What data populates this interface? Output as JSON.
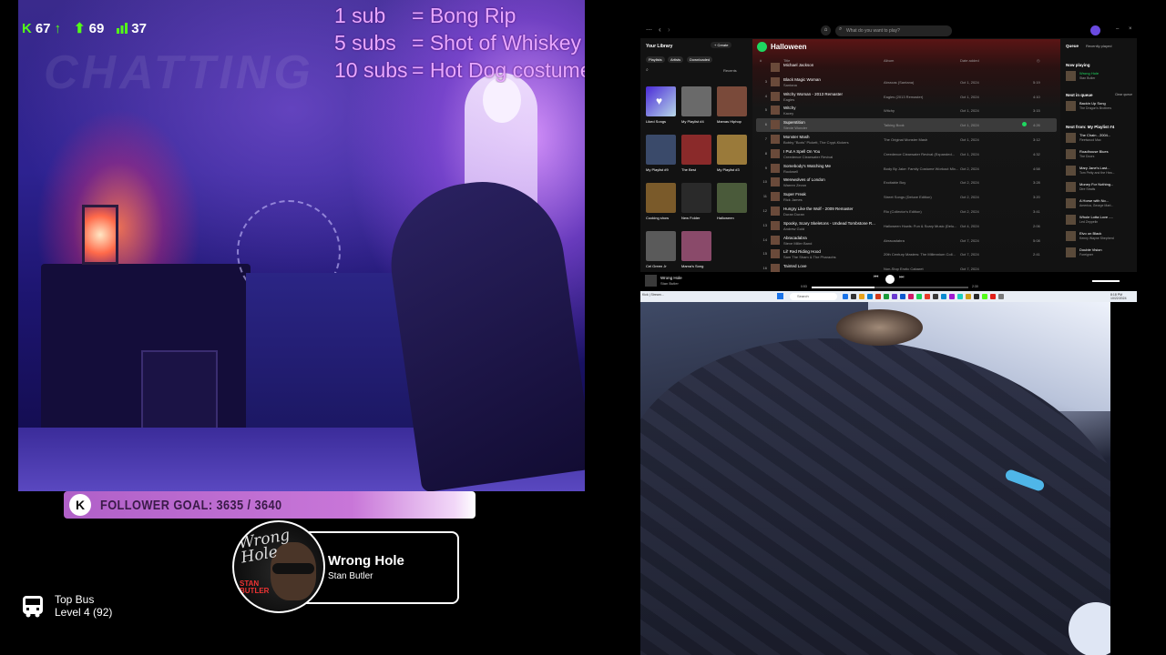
{
  "stream": {
    "stats": [
      {
        "icon": "kick-icon",
        "glyph": "K",
        "value": "67",
        "trend": "↑"
      },
      {
        "icon": "person-icon",
        "glyph": "⬆",
        "value": "69"
      },
      {
        "icon": "bars-icon",
        "glyph": "▮",
        "value": "37"
      }
    ],
    "watermark": "CHATTING",
    "sub_goals": [
      {
        "count": "1 sub",
        "reward": "= Bong Rip"
      },
      {
        "count": "5 subs",
        "reward": "= Shot of Whiskey"
      },
      {
        "count": "10 subs",
        "reward": "= Hot Dog costume"
      }
    ],
    "follower_goal": {
      "label": "FOLLOWER GOAL: 3635 / 3640",
      "current": 3635,
      "target": 3640
    },
    "now_playing": {
      "title": "Wrong Hole",
      "artist": "Stan Butler",
      "art_title": "Wrong Hole",
      "art_artist": "STAN BUTLER"
    },
    "top_bus": {
      "title": "Top Bus",
      "level": "Level 4  (92)"
    }
  },
  "spotify": {
    "search_placeholder": "What do you want to play?",
    "library_title": "Your Library",
    "create_label": "+ Create",
    "chips": [
      "Playlists",
      "Artists",
      "Downloaded"
    ],
    "sort_label": "Recents",
    "library_tiles": [
      {
        "name": "Liked Songs",
        "color": "#5b3be0"
      },
      {
        "name": "My Playlist #4",
        "color": "#6a6a6a"
      },
      {
        "name": "Mamas Hiphop",
        "color": "#7a4a3a"
      },
      {
        "name": "My Playlist #9",
        "color": "#3a4a6a"
      },
      {
        "name": "The Best",
        "color": "#8a2a2a"
      },
      {
        "name": "My Playlist #3",
        "color": "#9a7a3a"
      },
      {
        "name": "Cooking show",
        "color": "#7a5a2a"
      },
      {
        "name": "New Folder",
        "color": "#2a2a2a"
      },
      {
        "name": "Halloween",
        "color": "#4a5a3a"
      },
      {
        "name": "Cel Green Jr",
        "color": "#5a5a5a"
      },
      {
        "name": "Mama's Song",
        "color": "#8a4a6a"
      }
    ],
    "playlist_title": "Halloween",
    "columns": {
      "num": "#",
      "title": "Title",
      "album": "Album",
      "date": "Date added",
      "duration": "◷"
    },
    "tracks": [
      {
        "n": "",
        "title": "Michael Jackson",
        "artist": "",
        "album": "",
        "date": "",
        "dur": ""
      },
      {
        "n": "3",
        "title": "Black Magic Woman",
        "artist": "Santana",
        "album": "Abraxas (Santana)",
        "date": "Oct 1, 2024",
        "dur": "5:19"
      },
      {
        "n": "4",
        "title": "Witchy Woman - 2013 Remaster",
        "artist": "Eagles",
        "album": "Eagles (2013 Remaster)",
        "date": "Oct 1, 2024",
        "dur": "4:10"
      },
      {
        "n": "5",
        "title": "Witchy",
        "artist": "Kacey",
        "album": "Witchy",
        "date": "Oct 1, 2024",
        "dur": "3:15"
      },
      {
        "n": "6",
        "title": "Superstition",
        "artist": "Stevie Wonder",
        "album": "Talking Book",
        "date": "Oct 1, 2024",
        "dur": "4:26",
        "selected": true
      },
      {
        "n": "7",
        "title": "Monster Mash",
        "artist": "Bobby \"Boris\" Pickett, The Crypt-Kickers",
        "album": "The Original Monster Mash",
        "date": "Oct 1, 2024",
        "dur": "3:12"
      },
      {
        "n": "8",
        "title": "I Put A Spell On You",
        "artist": "Creedence Clearwater Revival",
        "album": "Creedence Clearwater Revival (Expanded...",
        "date": "Oct 1, 2024",
        "dur": "4:32"
      },
      {
        "n": "9",
        "title": "Somebody's Watching Me",
        "artist": "Rockwell",
        "album": "Body By Jake: Family Costume Workout Mix...",
        "date": "Oct 2, 2024",
        "dur": "4:58"
      },
      {
        "n": "10",
        "title": "Werewolves of London",
        "artist": "Warren Zevon",
        "album": "Excitable Boy",
        "date": "Oct 2, 2024",
        "dur": "3:28"
      },
      {
        "n": "11",
        "title": "Super Freak",
        "artist": "Rick James",
        "album": "Street Songs (Deluxe Edition)",
        "date": "Oct 2, 2024",
        "dur": "3:20"
      },
      {
        "n": "12",
        "title": "Hungry Like the Wolf - 2009 Remaster",
        "artist": "Duran Duran",
        "album": "Rio (Collector's Edition)",
        "date": "Oct 2, 2024",
        "dur": "3:41"
      },
      {
        "n": "13",
        "title": "Spooky, Scary Skeletons - Undead Tombstone R...",
        "artist": "Andrew Gold",
        "album": "Halloween Howls: Fun & Scary Music (Delu...",
        "date": "Oct 4, 2024",
        "dur": "2:06"
      },
      {
        "n": "14",
        "title": "Abracadabra",
        "artist": "Steve Miller Band",
        "album": "Abracadabra",
        "date": "Oct 7, 2024",
        "dur": "5:08"
      },
      {
        "n": "15",
        "title": "Lil' Red Riding Hood",
        "artist": "Sam The Sham & The Pharaohs",
        "album": "20th Century Masters: The Millennium Coll...",
        "date": "Oct 7, 2024",
        "dur": "2:41"
      },
      {
        "n": "16",
        "title": "Tainted Love",
        "artist": "",
        "album": "Non-Stop Erotic Cabaret",
        "date": "Oct 7, 2024",
        "dur": ""
      }
    ],
    "queue": {
      "tabs": [
        "Queue",
        "Recently played"
      ],
      "now_playing_label": "Now playing",
      "now_playing": {
        "title": "Wrong Hole",
        "artist": "Stan Butler"
      },
      "next_label": "Next in queue",
      "clear_label": "Clear queue",
      "next": [
        {
          "title": "Backin Up Song",
          "artist": "The Dragon's Brothers"
        }
      ],
      "next_from_label": "Next from: My Playlist #4",
      "next_from": [
        {
          "title": "The Chain - 2004...",
          "artist": "Fleetwood Mac"
        },
        {
          "title": "Roadhouse Blues",
          "artist": "The Doors"
        },
        {
          "title": "Mary Jane's Last...",
          "artist": "Tom Petty and the Hea..."
        },
        {
          "title": "Money For Nothing...",
          "artist": "Dire Straits"
        },
        {
          "title": "A Horse with No...",
          "artist": "America, George Mart..."
        },
        {
          "title": "Whole Lotta Love -...",
          "artist": "Led Zeppelin"
        },
        {
          "title": "Elvo on Black",
          "artist": "Kenny Wayne Shepherd"
        },
        {
          "title": "Double Vision",
          "artist": "Foreigner"
        }
      ]
    },
    "player": {
      "title": "Wrong Hole",
      "artist": "Stan Butler",
      "elapsed": "0:53",
      "total": "2:30",
      "progress": 0.4
    }
  },
  "taskbar": {
    "window_title": "Kick | Stream...",
    "search_placeholder": "Search",
    "clock_time": "8:18 PM",
    "clock_date": "10/22/2024",
    "app_colors": [
      "#1a73e8",
      "#333",
      "#e8a21a",
      "#0a7cd0",
      "#d03a1a",
      "#1a9a3a",
      "#6a3ad0",
      "#0a5ad0",
      "#d01a6a",
      "#1ad05a",
      "#e83a2a",
      "#3a3a3a",
      "#0a8ad0",
      "#a01ad0",
      "#1ad0c0",
      "#d0a01a",
      "#2a2a2a",
      "#53fc18",
      "#e0201a",
      "#7a7a7a"
    ]
  }
}
